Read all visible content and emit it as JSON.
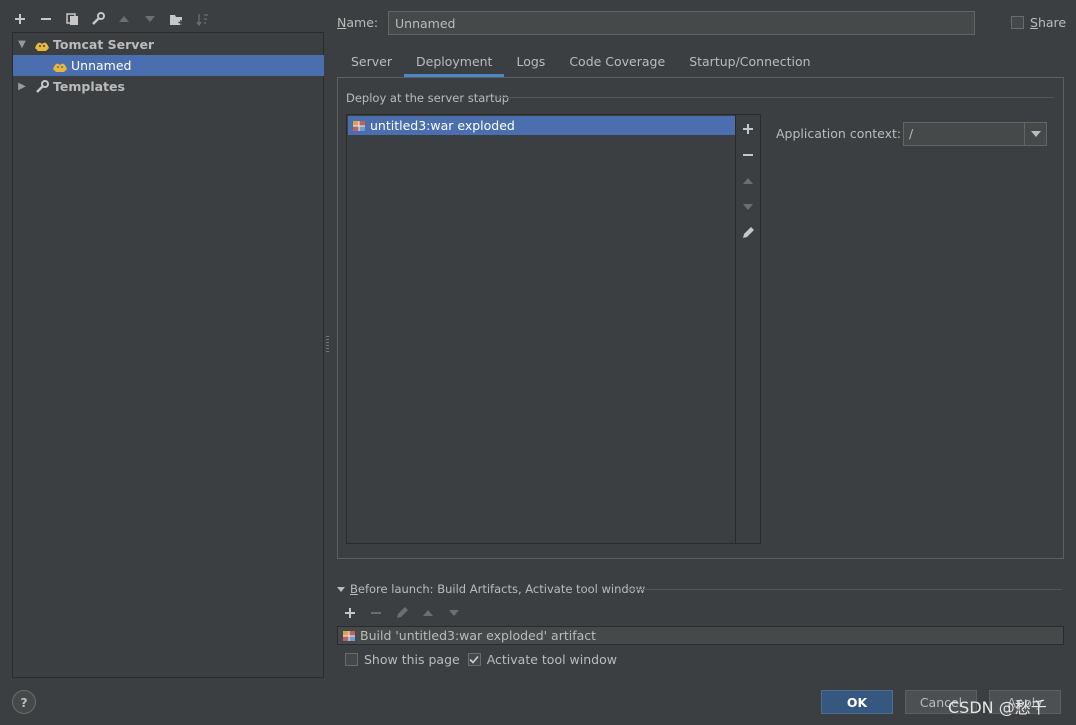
{
  "toolbar": {
    "buttons": [
      "add-icon",
      "remove-icon",
      "copy-icon",
      "wrench-icon",
      "move-up-icon",
      "move-down-icon",
      "new-folder-icon",
      "sort-icon"
    ]
  },
  "tree": {
    "items": [
      {
        "label": "Tomcat Server",
        "icon": "tomcat-icon",
        "expanded": true
      },
      {
        "label": "Unnamed",
        "icon": "tomcat-icon",
        "selected": true
      },
      {
        "label": "Templates",
        "icon": "wrench-icon",
        "expanded": false
      }
    ]
  },
  "name": {
    "label_prefix": "N",
    "label_rest": "ame:",
    "value": "Unnamed"
  },
  "share": {
    "label_prefix": "S",
    "label_rest": "hare",
    "checked": false
  },
  "tabs": [
    {
      "label": "Server"
    },
    {
      "label": "Deployment",
      "active": true
    },
    {
      "label": "Logs"
    },
    {
      "label": "Code Coverage"
    },
    {
      "label": "Startup/Connection"
    }
  ],
  "deploy": {
    "group_title": "Deploy at the server startup",
    "items": [
      {
        "label": "untitled3:war exploded",
        "icon": "artifact-icon",
        "selected": true
      }
    ],
    "side_tools": [
      "add-icon",
      "remove-icon",
      "move-up-icon",
      "move-down-icon",
      "edit-icon"
    ],
    "context_label": "Application context:",
    "context_value": "/"
  },
  "before_launch": {
    "title_prefix": "B",
    "title_rest": "efore launch: Build Artifacts, Activate tool window",
    "items": [
      {
        "label": "Build 'untitled3:war exploded' artifact",
        "icon": "artifact-icon"
      }
    ],
    "show_page_label": "Show this page",
    "show_page_checked": false,
    "activate_label": "Activate tool window",
    "activate_checked": true
  },
  "buttons": {
    "help": "?",
    "ok": "OK",
    "cancel": "Cancel",
    "apply": "Apply"
  },
  "watermark": "CSDN @愁千",
  "colors": {
    "background": "#3c3f41",
    "selection": "#4b6eaf",
    "tab_underline": "#4a88c7",
    "ok_button": "#365880"
  }
}
